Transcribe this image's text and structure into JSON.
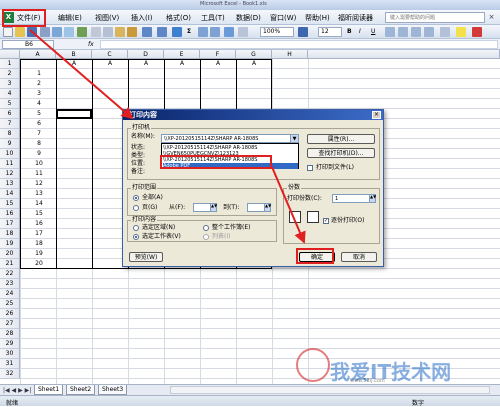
{
  "window": {
    "title": "Microsoft Excel - Book1.xls"
  },
  "menubar": {
    "items": [
      "文件(F)",
      "编辑(E)",
      "视图(V)",
      "插入(I)",
      "格式(O)",
      "工具(T)",
      "数据(D)",
      "窗口(W)",
      "帮助(H)",
      "福昕阅读器"
    ],
    "help_placeholder": "键入需要帮助的问题"
  },
  "toolbar": {
    "zoom": "100%",
    "font_size": "12"
  },
  "formulabar": {
    "cell_ref": "B6",
    "fx": "fx"
  },
  "grid": {
    "columns": [
      "A",
      "B",
      "C",
      "D",
      "E",
      "F",
      "G",
      "H"
    ],
    "rows": [
      "1",
      "2",
      "3",
      "4",
      "5",
      "6",
      "7",
      "8",
      "9",
      "10",
      "11",
      "12",
      "13",
      "14",
      "15",
      "16",
      "17",
      "18",
      "19",
      "20",
      "21",
      "22",
      "23",
      "24",
      "25",
      "26",
      "27",
      "28",
      "29",
      "30",
      "31",
      "32"
    ],
    "header_row_values": [
      "A",
      "A",
      "A",
      "A",
      "A",
      "A"
    ],
    "a_column_values": [
      "1",
      "2",
      "3",
      "4",
      "5",
      "6",
      "7",
      "8",
      "9",
      "10",
      "11",
      "12",
      "13",
      "14",
      "15",
      "16",
      "17",
      "18",
      "19",
      "20"
    ]
  },
  "sheets": {
    "tabs": [
      "Sheet1",
      "Sheet2",
      "Sheet3"
    ],
    "active": "Sheet1",
    "nav": "|◀ ◀ ▶ ▶|"
  },
  "statusbar": {
    "left": "就绪",
    "right": "数字"
  },
  "dialog": {
    "title": "打印内容",
    "printer_group": "打印机",
    "name_label": "名称(M):",
    "printer_selected": "\\\\XP-20120515114Z\\SHARP AR-1808S",
    "printer_list": [
      "\\\\XP-20120515114Z\\SHARP AR-1808S",
      "\\\\GVEN650PUEGCNVZ\\123123",
      "\\\\XP-20120515114Z\\SHARP AR-1808S",
      "Adobe PDF"
    ],
    "status_label": "状态:",
    "type_label": "类型:",
    "where_label": "位置:",
    "comment_label": "备注:",
    "properties_btn": "属性(R)...",
    "find_printer_btn": "查找打印机(D)...",
    "print_to_file": "打印到文件(L)",
    "range_group": "打印范围",
    "range_all": "全部(A)",
    "range_pages": "页(G)",
    "from_label": "从(F):",
    "to_label": "到(T):",
    "copies_group": "份数",
    "copies_label": "打印份数(C):",
    "copies_value": "1",
    "collate": "逐份打印(O)",
    "content_group": "打印内容",
    "content_selection": "选定区域(N)",
    "content_workbook": "整个工作簿(E)",
    "content_sheet": "选定工作表(V)",
    "content_list": "列表(I)",
    "preview_btn": "预览(W)",
    "ok_btn": "确定",
    "cancel_btn": "取消"
  },
  "watermark": {
    "brand": "我爱IT技术网",
    "url": "www.52ij.com"
  },
  "colors": {
    "annotation_red": "#e02020",
    "dialog_title": "#0a246a",
    "excel_green": "#1e7d3a"
  }
}
